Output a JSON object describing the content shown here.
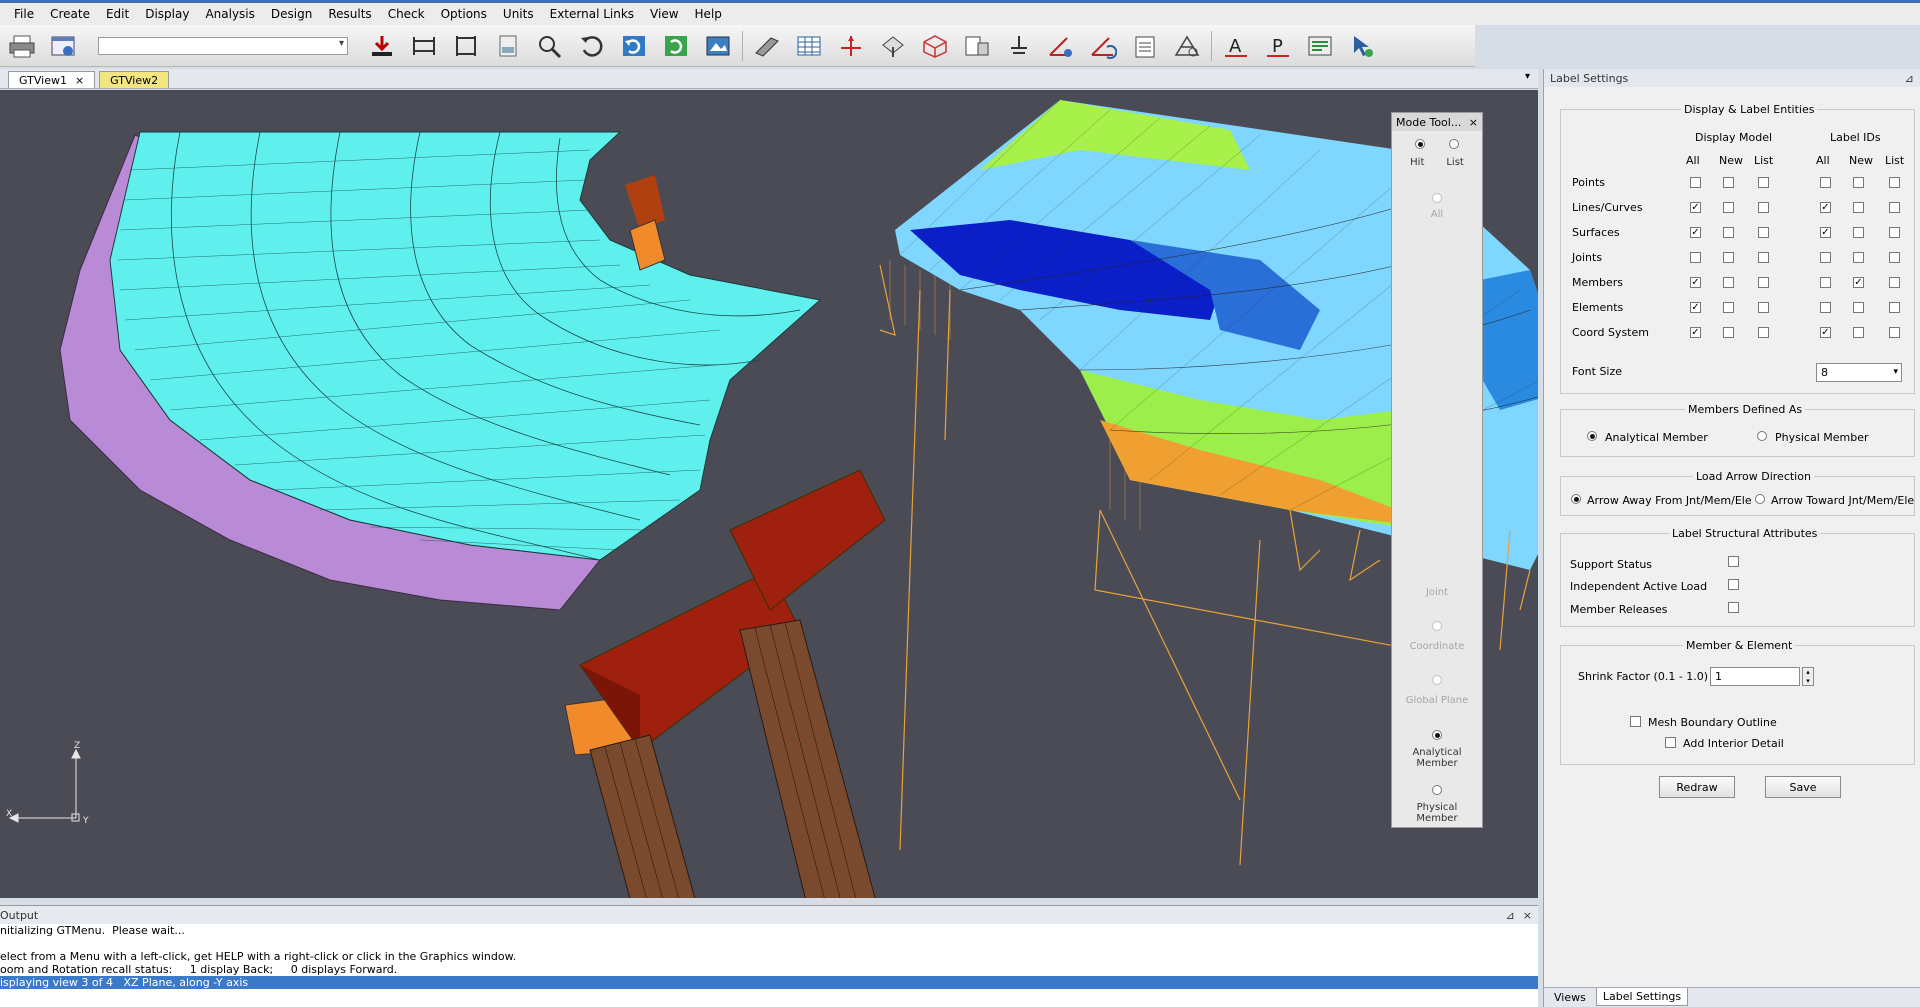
{
  "menu": [
    "File",
    "Create",
    "Edit",
    "Display",
    "Analysis",
    "Design",
    "Results",
    "Check",
    "Options",
    "Units",
    "External Links",
    "View",
    "Help"
  ],
  "toolbar": {
    "combo_value": "",
    "icons": [
      "printer-icon",
      "model-info-icon",
      "download-icon",
      "frame-view-icon",
      "frame-icon",
      "document-icon",
      "zoom-icon",
      "undo-icon",
      "refresh-icon",
      "redraw-icon",
      "view-image-icon",
      "plane-icon",
      "spreadsheet-icon",
      "axis-icon",
      "move-icon",
      "cube-icon",
      "properties-icon",
      "support-icon",
      "angle-icon",
      "rotate-icon",
      "clipboard-icon",
      "structure-icon",
      "label-a-icon",
      "label-p-icon",
      "settings-icon",
      "pointer-icon"
    ]
  },
  "tabs": [
    {
      "label": "GTView1",
      "close": "×"
    },
    {
      "label": "GTView2"
    }
  ],
  "mode_tool": {
    "title": "Mode Tool...",
    "close": "×",
    "hit": "Hit",
    "list": "List",
    "all": "All",
    "joint": "Joint",
    "coordinate": "Coordinate",
    "global_plane": "Global Plane",
    "analytical_member": "Analytical Member",
    "physical_member": "Physical Member"
  },
  "output": {
    "title": "Output",
    "pin": "⊿",
    "close": "×",
    "lines": [
      "nitializing GTMenu.  Please wait...",
      "",
      "elect from a Menu with a left-click, get HELP with a right-click or click in the Graphics window.",
      "oom and Rotation recall status:     1 display Back;     0 displays Forward.",
      "isplaying view 3 of 4   XZ Plane, along -Y axis"
    ]
  },
  "axis": {
    "z": "Z",
    "x": "X",
    "y": "Y"
  },
  "label_settings": {
    "title": "Label Settings",
    "pin": "⊿",
    "display_entities_title": "Display & Label Entities",
    "display_model": "Display Model",
    "label_ids": "Label IDs",
    "col_all": "All",
    "col_new": "New",
    "col_list": "List",
    "rows": [
      {
        "label": "Points",
        "checks": [
          false,
          false,
          false,
          false,
          false,
          false
        ]
      },
      {
        "label": "Lines/Curves",
        "checks": [
          true,
          false,
          false,
          true,
          false,
          false
        ]
      },
      {
        "label": "Surfaces",
        "checks": [
          true,
          false,
          false,
          true,
          false,
          false
        ]
      },
      {
        "label": "Joints",
        "checks": [
          false,
          false,
          false,
          false,
          false,
          false
        ]
      },
      {
        "label": "Members",
        "checks": [
          true,
          false,
          false,
          false,
          true,
          false
        ]
      },
      {
        "label": "Elements",
        "checks": [
          true,
          false,
          false,
          false,
          false,
          false
        ]
      },
      {
        "label": "Coord System",
        "checks": [
          true,
          false,
          false,
          true,
          false,
          false
        ]
      }
    ],
    "font_size_label": "Font Size",
    "font_size_value": "8",
    "members_defined_title": "Members Defined As",
    "analytical_member": "Analytical Member",
    "physical_member": "Physical Member",
    "load_arrow_title": "Load Arrow Direction",
    "arrow_away": "Arrow Away From Jnt/Mem/Ele",
    "arrow_toward": "Arrow Toward Jnt/Mem/Ele",
    "label_struct_title": "Label Structural Attributes",
    "support_status": "Support Status",
    "independent_load": "Independent Active Load",
    "member_releases": "Member Releases",
    "member_element_title": "Member & Element",
    "shrink_label": "Shrink Factor (0.1 - 1.0)",
    "shrink_value": "1",
    "mesh_boundary": "Mesh Boundary Outline",
    "add_interior": "Add Interior Detail",
    "redraw": "Redraw",
    "save": "Save"
  },
  "panel_tabs": [
    "Views",
    "Label Settings"
  ],
  "colors": {
    "viewport_bg": "#4b4b55",
    "deck_cyan": "#5ff0ee",
    "girder_lilac": "#b98ad6",
    "cap_red": "#a0200f",
    "pier_brown": "#7a4a2e",
    "bearing_orange": "#f08a2a",
    "accent_blue": "#3b79c9"
  }
}
